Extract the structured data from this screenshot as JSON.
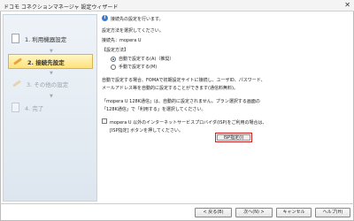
{
  "window": {
    "title": "ドコモ コネクションマネージャ 設定ウィザード",
    "close_glyph": "✕"
  },
  "sidebar": {
    "steps": [
      {
        "label": "1. 利用機器設定",
        "state": "done"
      },
      {
        "label": "2. 接続先設定",
        "state": "active"
      },
      {
        "label": "3. その他の設定",
        "state": "disabled"
      },
      {
        "label": "4. 完了",
        "state": "disabled"
      }
    ],
    "arrow_glyph": "▼"
  },
  "main": {
    "header": "接続先の設定を行います。",
    "instruction": "設定方法を選択してください。",
    "destination": "接続先：mopera U",
    "method_label": "【設定方法】",
    "options": [
      {
        "label": "自動で設定する(A)（推奨）",
        "selected": true
      },
      {
        "label": "手動で設定する(M)",
        "selected": false
      }
    ],
    "auto_desc_1": "自動で設定する場合、FOMAで初期設定サイトに接続し、ユーザID、パスワード、",
    "auto_desc_2": "メールアドレス等を自動的に設定することができます(通信料無料)。",
    "note_1": "「mopera U 128K通信」は、自動的に設定されません。プラン選択する画面の",
    "note_2": "「128K通信」で「利用する」を選択してください。",
    "isp_text_1": "mopera U 以外のインターネットサービスプロバイダ(ISP)をご利用の場合は、",
    "isp_text_2": "[ISP指定] ボタンを押してください。",
    "isp_button": "ISP指定(I)"
  },
  "footer": {
    "back": "< 戻る(B)",
    "next": "次へ(N) >",
    "cancel": "キャンセル",
    "help": "ヘルプ(H)"
  },
  "colors": {
    "highlight_border": "#cc2222",
    "active_step": "#ffe27a"
  }
}
